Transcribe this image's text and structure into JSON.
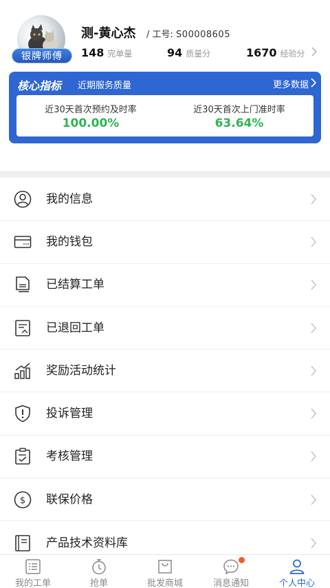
{
  "profile": {
    "badge": "银牌师傅",
    "name": "测-黄心杰",
    "job_prefix": "/ 工号:",
    "job_number": "S00008605",
    "stats": [
      {
        "value": "148",
        "label": "完单量"
      },
      {
        "value": "94",
        "label": "质量分"
      },
      {
        "value": "1670",
        "label": "经验分"
      }
    ]
  },
  "metrics": {
    "title": "核心指标",
    "subtitle": "近期服务质量",
    "more": "更多数据",
    "items": [
      {
        "label": "近30天首次预约及时率",
        "value": "100.00%"
      },
      {
        "label": "近30天首次上门准时率",
        "value": "63.64%"
      }
    ]
  },
  "menu": [
    {
      "label": "我的信息",
      "icon": "person-icon"
    },
    {
      "label": "我的钱包",
      "icon": "wallet-icon"
    },
    {
      "label": "已结算工单",
      "icon": "settled-order-icon"
    },
    {
      "label": "已退回工单",
      "icon": "returned-order-icon"
    },
    {
      "label": "奖励活动统计",
      "icon": "chart-icon"
    },
    {
      "label": "投诉管理",
      "icon": "shield-alert-icon"
    },
    {
      "label": "考核管理",
      "icon": "clipboard-check-icon"
    },
    {
      "label": "联保价格",
      "icon": "dollar-circle-icon"
    },
    {
      "label": "产品技术资料库",
      "icon": "book-icon"
    }
  ],
  "tabs": [
    {
      "label": "我的工单",
      "icon": "list-icon",
      "active": false
    },
    {
      "label": "抢单",
      "icon": "stopwatch-icon",
      "active": false
    },
    {
      "label": "批发商城",
      "icon": "shopping-bag-icon",
      "active": false
    },
    {
      "label": "消息通知",
      "icon": "message-icon",
      "active": false
    },
    {
      "label": "个人中心",
      "icon": "user-icon",
      "active": true
    }
  ],
  "colors": {
    "accent": "#2e66d2",
    "metric_value": "#2fb44e",
    "notification_dot": "#f55a2b"
  }
}
